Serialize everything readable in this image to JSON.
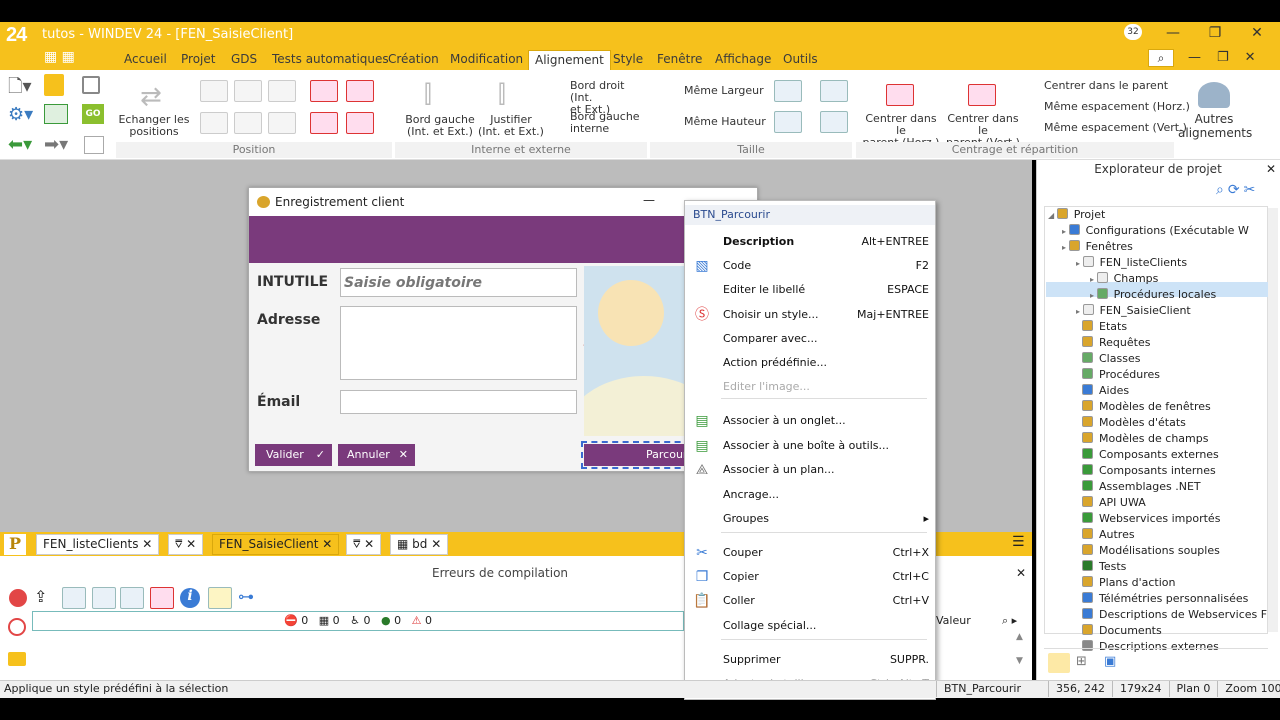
{
  "app": {
    "logo": "24",
    "title": "tutos - WINDEV 24 - [FEN_SaisieClient]",
    "badge": "32"
  },
  "menu": [
    "Accueil",
    "Projet",
    "GDS",
    "Tests automatiques",
    "Création",
    "Modification",
    "Alignement",
    "Style",
    "Fenêtre",
    "Affichage",
    "Outils"
  ],
  "menu_active": "Alignement",
  "ribbon": {
    "exchange": "Echanger les\npositions",
    "group_position": "Position",
    "group_interne": "Interne et externe",
    "group_taille": "Taille",
    "group_centrage": "Centrage et répartition",
    "bord_gauche": "Bord gauche\n(Int. et Ext.)",
    "justifier": "Justifier\n(Int. et Ext.)",
    "bord_droit": "Bord droit (Int.\net Ext.)",
    "bord_interne": "Bord gauche\ninterne",
    "meme_largeur": "Même Largeur",
    "meme_hauteur": "Même Hauteur",
    "centrer_horz": "Centrer dans le\nparent (Horz.)",
    "centrer_vert": "Centrer dans le\nparent (Vert.)",
    "centrer_parent": "Centrer dans le parent",
    "espacement_h": "Même espacement (Horz.)",
    "espacement_v": "Même espacement (Vert.)",
    "autres": "Autres\nalignements"
  },
  "dialog": {
    "title": "Enregistrement client",
    "intitule": "INTUTILE",
    "intitule_placeholder": "Saisie obligatoire",
    "adresse": "Adresse",
    "email": "Émail",
    "valider": "Valider",
    "annuler": "Annuler",
    "parcourir": "Parcouri"
  },
  "doc_tabs": [
    "FEN_listeClients",
    "FEN_SaisieClient",
    "bd"
  ],
  "doc_tab_active": "FEN_SaisieClient",
  "errors": {
    "title": "Erreurs de compilation",
    "counts": [
      "0",
      "0",
      "0",
      "0",
      "0"
    ],
    "valeur": "Valeur"
  },
  "context_menu": {
    "header": "BTN_Parcourir",
    "items": [
      {
        "label": "Description",
        "shortcut": "Alt+ENTREE",
        "bold": true
      },
      {
        "label": "Code",
        "shortcut": "F2"
      },
      {
        "label": "Editer le libellé",
        "shortcut": "ESPACE"
      },
      {
        "label": "Choisir un style...",
        "shortcut": "Maj+ENTREE"
      },
      {
        "label": "Comparer avec...",
        "shortcut": ""
      },
      {
        "label": "Action prédéfinie...",
        "shortcut": ""
      },
      {
        "label": "Editer l'image...",
        "shortcut": "",
        "disabled": true
      },
      {
        "label": "Associer à un onglet...",
        "shortcut": ""
      },
      {
        "label": "Associer à une boîte à outils...",
        "shortcut": ""
      },
      {
        "label": "Associer à un plan...",
        "shortcut": ""
      },
      {
        "label": "Ancrage...",
        "shortcut": ""
      },
      {
        "label": "Groupes",
        "shortcut": "▸"
      },
      {
        "label": "Couper",
        "shortcut": "Ctrl+X"
      },
      {
        "label": "Copier",
        "shortcut": "Ctrl+C"
      },
      {
        "label": "Coller",
        "shortcut": "Ctrl+V"
      },
      {
        "label": "Collage spécial...",
        "shortcut": ""
      },
      {
        "label": "Supprimer",
        "shortcut": "SUPPR."
      },
      {
        "label": "Adapter la taille",
        "shortcut": "Ctrl+Alt+T",
        "disabled": true
      }
    ]
  },
  "explorer": {
    "title": "Explorateur de projet",
    "nodes": [
      "Projet",
      "Configurations (Exécutable W",
      "Fenêtres",
      "FEN_listeClients",
      "Champs",
      "Procédures locales",
      "FEN_SaisieClient",
      "Etats",
      "Requêtes",
      "Classes",
      "Procédures",
      "Aides",
      "Modèles de fenêtres",
      "Modèles d'états",
      "Modèles de champs",
      "Composants externes",
      "Composants internes",
      "Assemblages .NET",
      "API UWA",
      "Webservices importés",
      "Autres",
      "Modélisations souples",
      "Tests",
      "Plans d'action",
      "Télémétries personnalisées",
      "Descriptions de Webservices F",
      "Documents",
      "Descriptions externes"
    ]
  },
  "status": {
    "message": "Applique un style prédéfini à la sélection",
    "control": "BTN_Parcourir",
    "position": "356, 242",
    "size": "179x24",
    "plan": "Plan 0",
    "zoom": "Zoom 100%"
  }
}
